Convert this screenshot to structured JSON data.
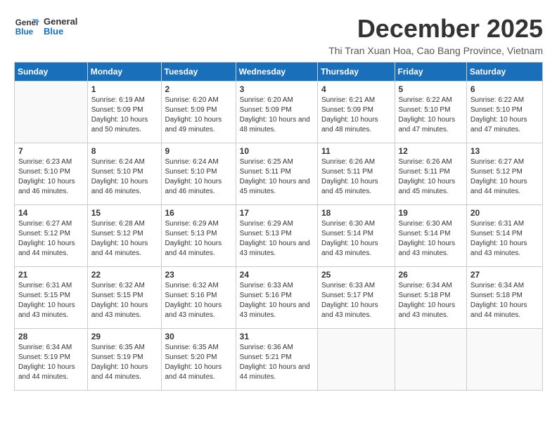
{
  "header": {
    "logo_line1": "General",
    "logo_line2": "Blue",
    "month_year": "December 2025",
    "subtitle": "Thi Tran Xuan Hoa, Cao Bang Province, Vietnam"
  },
  "weekdays": [
    "Sunday",
    "Monday",
    "Tuesday",
    "Wednesday",
    "Thursday",
    "Friday",
    "Saturday"
  ],
  "weeks": [
    [
      {
        "day": null
      },
      {
        "day": "1",
        "sunrise": "6:19 AM",
        "sunset": "5:09 PM",
        "daylight": "10 hours and 50 minutes."
      },
      {
        "day": "2",
        "sunrise": "6:20 AM",
        "sunset": "5:09 PM",
        "daylight": "10 hours and 49 minutes."
      },
      {
        "day": "3",
        "sunrise": "6:20 AM",
        "sunset": "5:09 PM",
        "daylight": "10 hours and 48 minutes."
      },
      {
        "day": "4",
        "sunrise": "6:21 AM",
        "sunset": "5:09 PM",
        "daylight": "10 hours and 48 minutes."
      },
      {
        "day": "5",
        "sunrise": "6:22 AM",
        "sunset": "5:10 PM",
        "daylight": "10 hours and 47 minutes."
      },
      {
        "day": "6",
        "sunrise": "6:22 AM",
        "sunset": "5:10 PM",
        "daylight": "10 hours and 47 minutes."
      }
    ],
    [
      {
        "day": "7",
        "sunrise": "6:23 AM",
        "sunset": "5:10 PM",
        "daylight": "10 hours and 46 minutes."
      },
      {
        "day": "8",
        "sunrise": "6:24 AM",
        "sunset": "5:10 PM",
        "daylight": "10 hours and 46 minutes."
      },
      {
        "day": "9",
        "sunrise": "6:24 AM",
        "sunset": "5:10 PM",
        "daylight": "10 hours and 46 minutes."
      },
      {
        "day": "10",
        "sunrise": "6:25 AM",
        "sunset": "5:11 PM",
        "daylight": "10 hours and 45 minutes."
      },
      {
        "day": "11",
        "sunrise": "6:26 AM",
        "sunset": "5:11 PM",
        "daylight": "10 hours and 45 minutes."
      },
      {
        "day": "12",
        "sunrise": "6:26 AM",
        "sunset": "5:11 PM",
        "daylight": "10 hours and 45 minutes."
      },
      {
        "day": "13",
        "sunrise": "6:27 AM",
        "sunset": "5:12 PM",
        "daylight": "10 hours and 44 minutes."
      }
    ],
    [
      {
        "day": "14",
        "sunrise": "6:27 AM",
        "sunset": "5:12 PM",
        "daylight": "10 hours and 44 minutes."
      },
      {
        "day": "15",
        "sunrise": "6:28 AM",
        "sunset": "5:12 PM",
        "daylight": "10 hours and 44 minutes."
      },
      {
        "day": "16",
        "sunrise": "6:29 AM",
        "sunset": "5:13 PM",
        "daylight": "10 hours and 44 minutes."
      },
      {
        "day": "17",
        "sunrise": "6:29 AM",
        "sunset": "5:13 PM",
        "daylight": "10 hours and 43 minutes."
      },
      {
        "day": "18",
        "sunrise": "6:30 AM",
        "sunset": "5:14 PM",
        "daylight": "10 hours and 43 minutes."
      },
      {
        "day": "19",
        "sunrise": "6:30 AM",
        "sunset": "5:14 PM",
        "daylight": "10 hours and 43 minutes."
      },
      {
        "day": "20",
        "sunrise": "6:31 AM",
        "sunset": "5:14 PM",
        "daylight": "10 hours and 43 minutes."
      }
    ],
    [
      {
        "day": "21",
        "sunrise": "6:31 AM",
        "sunset": "5:15 PM",
        "daylight": "10 hours and 43 minutes."
      },
      {
        "day": "22",
        "sunrise": "6:32 AM",
        "sunset": "5:15 PM",
        "daylight": "10 hours and 43 minutes."
      },
      {
        "day": "23",
        "sunrise": "6:32 AM",
        "sunset": "5:16 PM",
        "daylight": "10 hours and 43 minutes."
      },
      {
        "day": "24",
        "sunrise": "6:33 AM",
        "sunset": "5:16 PM",
        "daylight": "10 hours and 43 minutes."
      },
      {
        "day": "25",
        "sunrise": "6:33 AM",
        "sunset": "5:17 PM",
        "daylight": "10 hours and 43 minutes."
      },
      {
        "day": "26",
        "sunrise": "6:34 AM",
        "sunset": "5:18 PM",
        "daylight": "10 hours and 43 minutes."
      },
      {
        "day": "27",
        "sunrise": "6:34 AM",
        "sunset": "5:18 PM",
        "daylight": "10 hours and 44 minutes."
      }
    ],
    [
      {
        "day": "28",
        "sunrise": "6:34 AM",
        "sunset": "5:19 PM",
        "daylight": "10 hours and 44 minutes."
      },
      {
        "day": "29",
        "sunrise": "6:35 AM",
        "sunset": "5:19 PM",
        "daylight": "10 hours and 44 minutes."
      },
      {
        "day": "30",
        "sunrise": "6:35 AM",
        "sunset": "5:20 PM",
        "daylight": "10 hours and 44 minutes."
      },
      {
        "day": "31",
        "sunrise": "6:36 AM",
        "sunset": "5:21 PM",
        "daylight": "10 hours and 44 minutes."
      },
      {
        "day": null
      },
      {
        "day": null
      },
      {
        "day": null
      }
    ]
  ]
}
